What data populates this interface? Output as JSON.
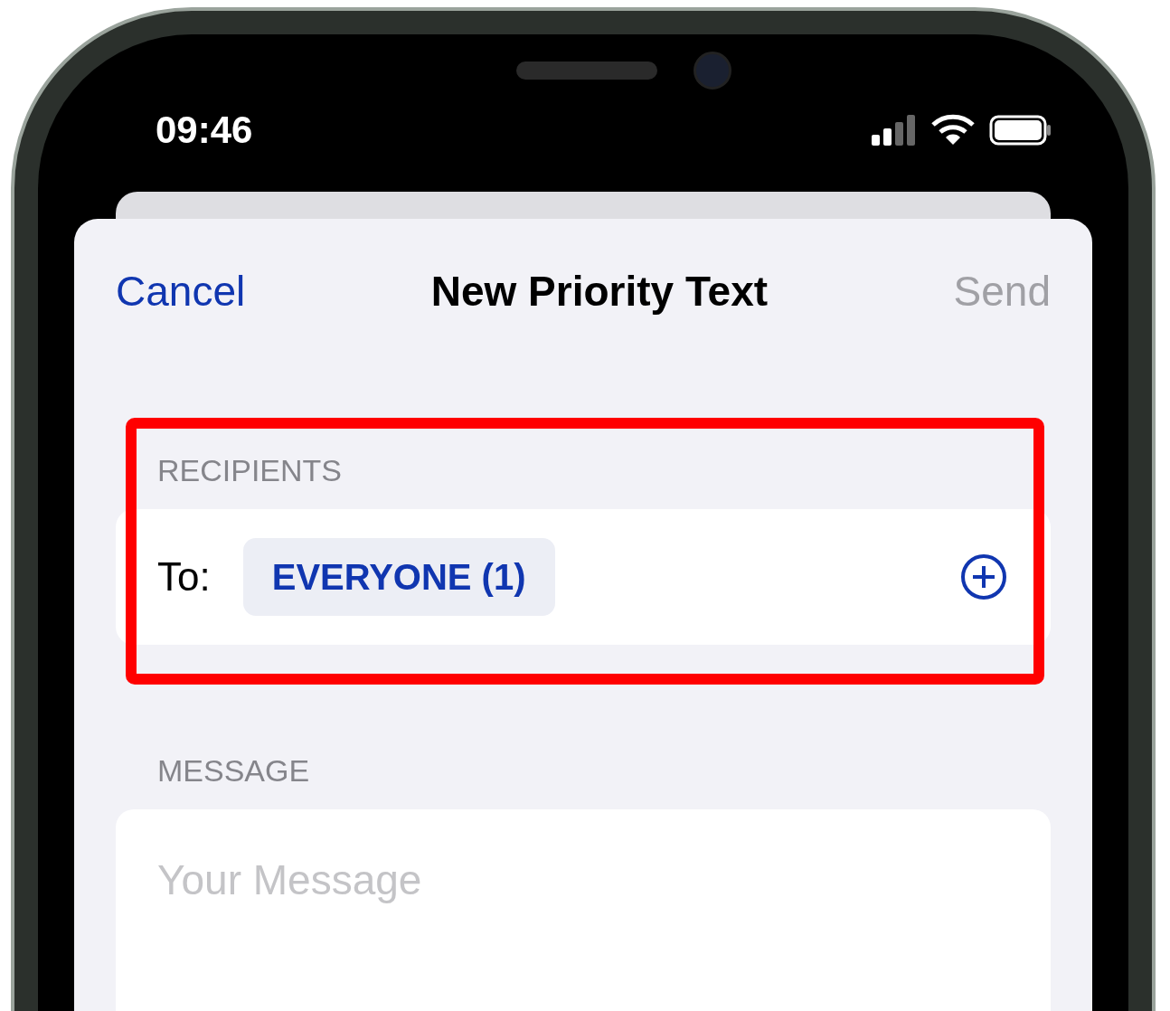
{
  "status_bar": {
    "time": "09:46"
  },
  "nav": {
    "cancel": "Cancel",
    "title": "New Priority Text",
    "send": {
      "label": "Send",
      "disabled": true
    }
  },
  "recipients": {
    "header": "RECIPIENTS",
    "to_label": "To:",
    "chip": "EVERYONE (1)",
    "highlighted": true
  },
  "message": {
    "header": "MESSAGE",
    "placeholder": "Your Message"
  }
}
